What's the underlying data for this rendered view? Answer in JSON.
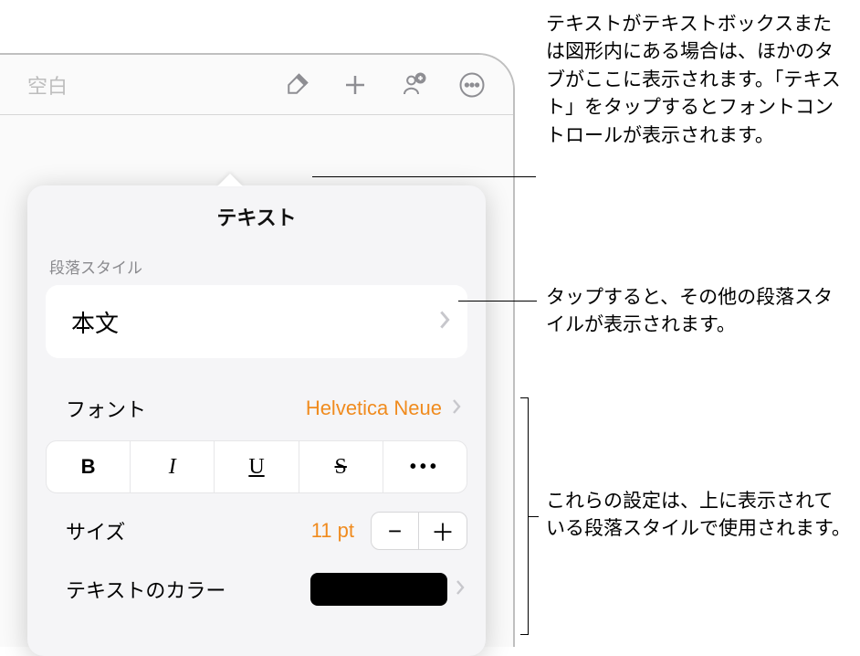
{
  "toolbar": {
    "back": "空白"
  },
  "panel": {
    "title": "テキスト",
    "section_style": "段落スタイル",
    "style_name": "本文",
    "font_label": "フォント",
    "font_value": "Helvetica Neue",
    "bold": "B",
    "italic": "I",
    "underline": "U",
    "strike": "S",
    "more": "•••",
    "size_label": "サイズ",
    "size_value": "11 pt",
    "stepper_minus": "−",
    "stepper_plus": "＋",
    "color_label": "テキストのカラー",
    "color_hex": "#000000"
  },
  "callouts": {
    "c1": "テキストがテキストボックスまたは図形内にある場合は、ほかのタブがここに表示されます。「テキスト」をタップするとフォントコントロールが表示されます。",
    "c2": "タップすると、その他の段落スタイルが表示されます。",
    "c3": "これらの設定は、上に表示されている段落スタイルで使用されます。"
  }
}
